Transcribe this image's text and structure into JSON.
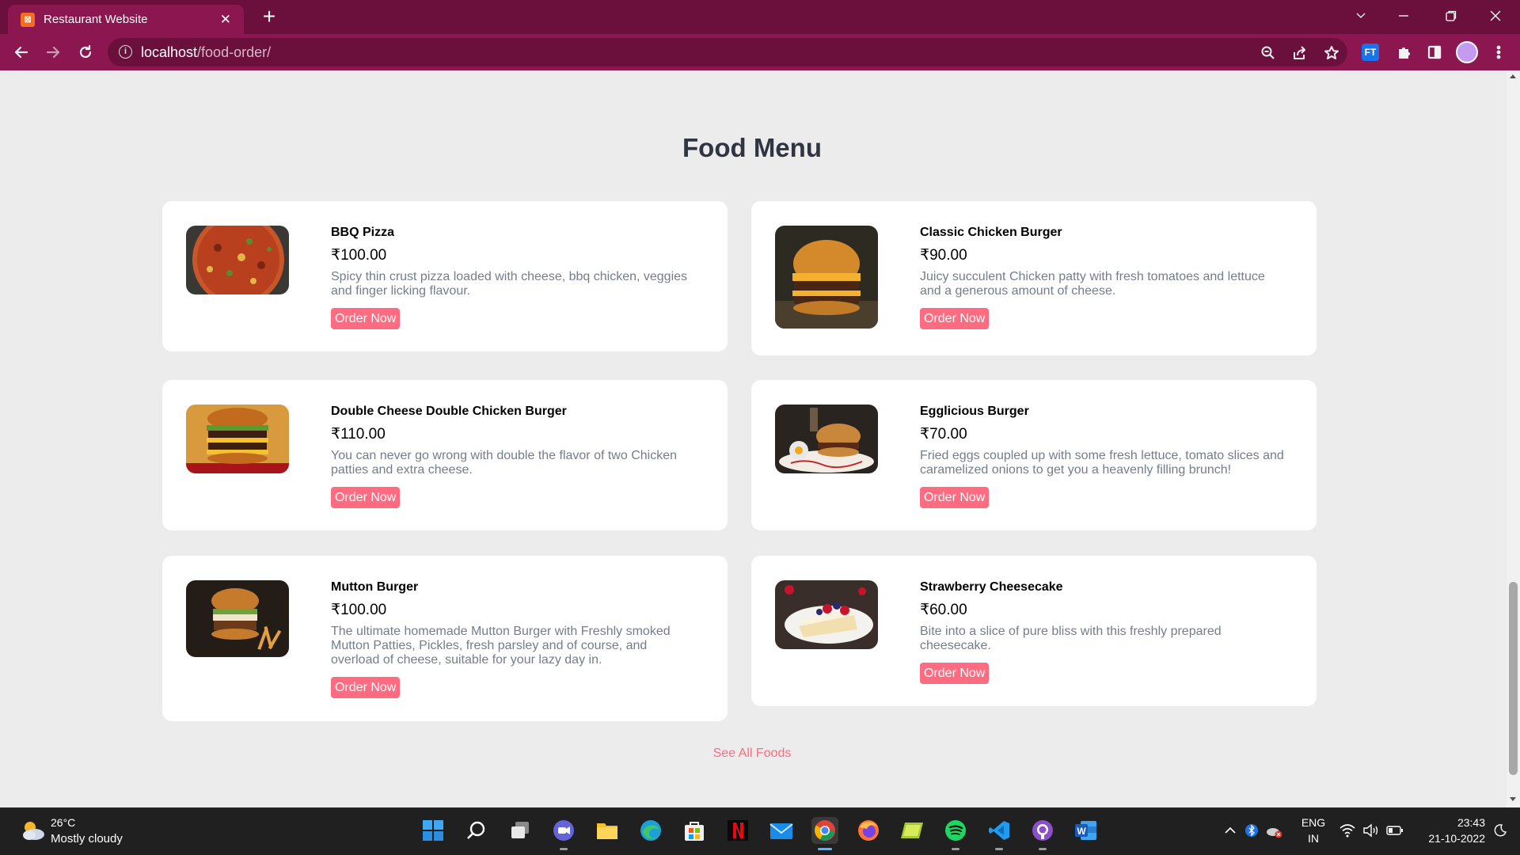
{
  "browser": {
    "tab_title": "Restaurant Website",
    "tab_favicon": "⊠",
    "url_host": "localhost",
    "url_path": "/food-order/",
    "extension_badge": "FT"
  },
  "page": {
    "title": "Food Menu",
    "order_label": "Order Now",
    "see_all": "See All Foods",
    "foods": [
      {
        "name": "BBQ Pizza",
        "price": "₹100.00",
        "description": "Spicy thin crust pizza loaded with cheese, bbq chicken, veggies and finger licking flavour.",
        "image": "pizza-image"
      },
      {
        "name": "Classic Chicken Burger",
        "price": "₹90.00",
        "description": "Juicy succulent Chicken patty with fresh tomatoes and lettuce and a generous amount of cheese.",
        "image": "burger-image"
      },
      {
        "name": "Double Cheese Double Chicken Burger",
        "price": "₹110.00",
        "description": "You can never go wrong with double the flavor of two Chicken patties and extra cheese.",
        "image": "double-burger-image"
      },
      {
        "name": "Egglicious Burger",
        "price": "₹70.00",
        "description": "Fried eggs coupled up with some fresh lettuce, tomato slices and caramelized onions to get you a heavenly filling brunch!",
        "image": "egg-burger-image"
      },
      {
        "name": "Mutton Burger",
        "price": "₹100.00",
        "description": "The ultimate homemade Mutton Burger with Freshly smoked Mutton Patties, Pickles, fresh parsley and of course, and overload of cheese, suitable for your lazy day in.",
        "image": "mutton-burger-image"
      },
      {
        "name": "Strawberry Cheesecake",
        "price": "₹60.00",
        "description": "Bite into a slice of pure bliss with this freshly prepared cheesecake.",
        "image": "cheesecake-image"
      }
    ]
  },
  "taskbar": {
    "weather_temp": "26°C",
    "weather_desc": "Mostly cloudy",
    "lang_top": "ENG",
    "lang_bottom": "IN",
    "time": "23:43",
    "date": "21-10-2022",
    "apps": [
      "start-icon",
      "search-icon",
      "task-view-icon",
      "chat-icon",
      "file-explorer-icon",
      "edge-icon",
      "store-icon",
      "netflix-icon",
      "mail-icon",
      "chrome-icon",
      "firefox-icon",
      "notes-icon",
      "spotify-icon",
      "vscode-icon",
      "github-icon",
      "word-icon"
    ]
  }
}
